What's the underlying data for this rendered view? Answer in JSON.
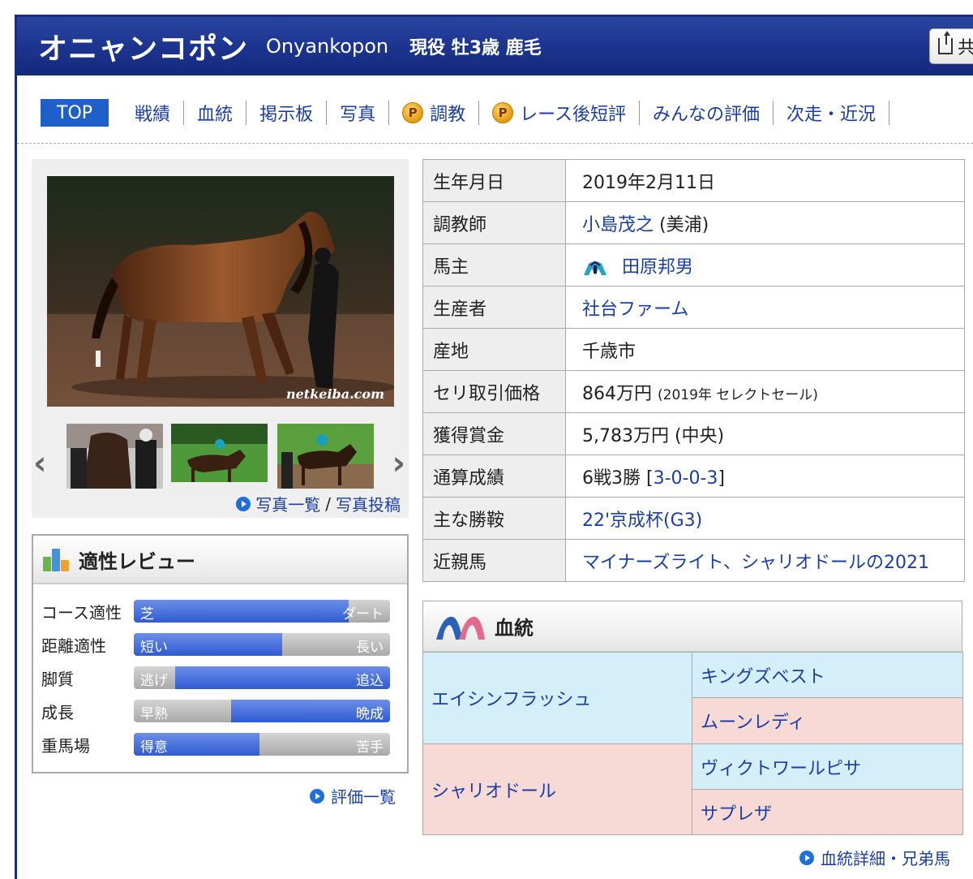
{
  "header": {
    "name_ja": "オニャンコポン",
    "name_en": "Onyankopon",
    "status": "現役 牡3歳 鹿毛",
    "share_label": "共"
  },
  "nav": {
    "items": [
      {
        "label": "TOP",
        "active": true
      },
      {
        "label": "戦績"
      },
      {
        "label": "血統"
      },
      {
        "label": "掲示板"
      },
      {
        "label": "写真"
      },
      {
        "label": "調教",
        "premium": true
      },
      {
        "label": "レース後短評",
        "premium": true
      },
      {
        "label": "みんなの評価"
      },
      {
        "label": "次走・近況"
      }
    ],
    "premium_badge": "P"
  },
  "photo": {
    "watermark": "netkeiba.com",
    "links": {
      "list": "写真一覧",
      "separator": "/",
      "post": "写真投稿"
    }
  },
  "review": {
    "title": "適性レビュー",
    "rows": [
      {
        "label": "コース適性",
        "left": "芝",
        "right": "ダート",
        "fill_start": 0.0,
        "fill_end": 0.84
      },
      {
        "label": "距離適性",
        "left": "短い",
        "right": "長い",
        "fill_start": 0.0,
        "fill_end": 0.58
      },
      {
        "label": "脚質",
        "left": "逃げ",
        "right": "追込",
        "fill_start": 0.16,
        "fill_end": 1.0
      },
      {
        "label": "成長",
        "left": "早熟",
        "right": "晩成",
        "fill_start": 0.38,
        "fill_end": 1.0
      },
      {
        "label": "重馬場",
        "left": "得意",
        "right": "苦手",
        "fill_start": 0.0,
        "fill_end": 0.49
      }
    ],
    "link": "評価一覧"
  },
  "profile": {
    "birthday": {
      "label": "生年月日",
      "value": "2019年2月11日"
    },
    "trainer": {
      "label": "調教師",
      "name": "小島茂之",
      "suffix": "(美浦)"
    },
    "owner": {
      "label": "馬主",
      "name": "田原邦男"
    },
    "breeder": {
      "label": "生産者",
      "name": "社台ファーム"
    },
    "birthplace": {
      "label": "産地",
      "value": "千歳市"
    },
    "auction": {
      "label": "セリ取引価格",
      "value": "864万円",
      "note": "(2019年 セレクトセール)"
    },
    "earnings": {
      "label": "獲得賞金",
      "value": "5,783万円 (中央)"
    },
    "record": {
      "label": "通算成績",
      "value": "6戦3勝",
      "open": "[",
      "detail": "3-0-0-3",
      "close": "]"
    },
    "wins": {
      "label": "主な勝鞍",
      "value": "22'京成杯(G3)"
    },
    "relatives": {
      "label": "近親馬",
      "value": "マイナーズライト、シャリオドールの2021"
    }
  },
  "pedigree": {
    "title": "血統",
    "sire": "エイシンフラッシュ",
    "sire_sire": "キングズベスト",
    "sire_dam": "ムーンレディ",
    "dam": "シャリオドール",
    "dam_sire": "ヴィクトワールピサ",
    "dam_dam": "サプレザ",
    "link": "血統詳細・兄弟馬"
  },
  "colors": {
    "header_bg": "#1c3590",
    "link": "#1a3ea8",
    "bar_fill": "#2f5bd2",
    "male": "#d4eefa",
    "female": "#f7d9d6"
  }
}
